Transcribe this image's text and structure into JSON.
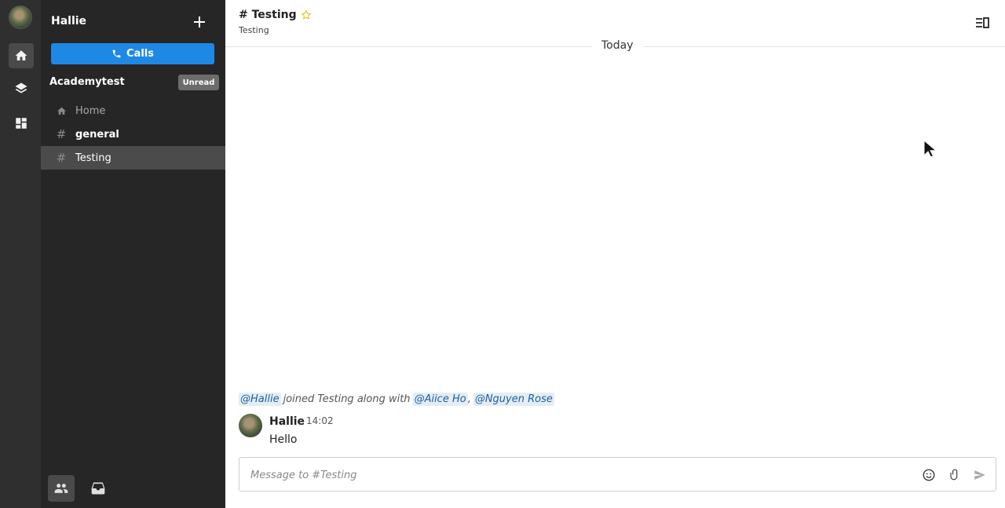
{
  "rail": {
    "items": [
      {
        "name": "home",
        "icon": "home-icon",
        "active": true
      },
      {
        "name": "layers",
        "icon": "layers-icon",
        "active": false
      },
      {
        "name": "apps",
        "icon": "grid-icon",
        "active": false
      }
    ]
  },
  "sidebar": {
    "user_name": "Hallie",
    "calls_label": "Calls",
    "team_name": "Academytest",
    "unread_label": "Unread",
    "channels": [
      {
        "label": "Home",
        "icon": "home-icon",
        "state": "dim"
      },
      {
        "label": "general",
        "icon": "hash-icon",
        "state": "bold"
      },
      {
        "label": "Testing",
        "icon": "hash-icon",
        "state": "active"
      }
    ]
  },
  "header": {
    "title": "# Testing",
    "subtitle": "Testing"
  },
  "timeline": {
    "day_label": "Today",
    "system_message": {
      "mention_1": "@Hallie",
      "text": "joined Testing along with",
      "mention_2": "@Aiice Ho",
      "separator": ",",
      "mention_3": "@Nguyen Rose"
    },
    "messages": [
      {
        "author": "Hallie",
        "time": "14:02",
        "text": "Hello"
      }
    ]
  },
  "composer": {
    "placeholder": "Message to #Testing"
  },
  "colors": {
    "rail_bg": "#2f2f2f",
    "sidebar_bg": "#262626",
    "accent": "#1e88e5",
    "active_item": "#4b4b4b",
    "mention_bg": "#e3edf6",
    "mention_text": "#1f5e97",
    "star": "#e6b400"
  }
}
